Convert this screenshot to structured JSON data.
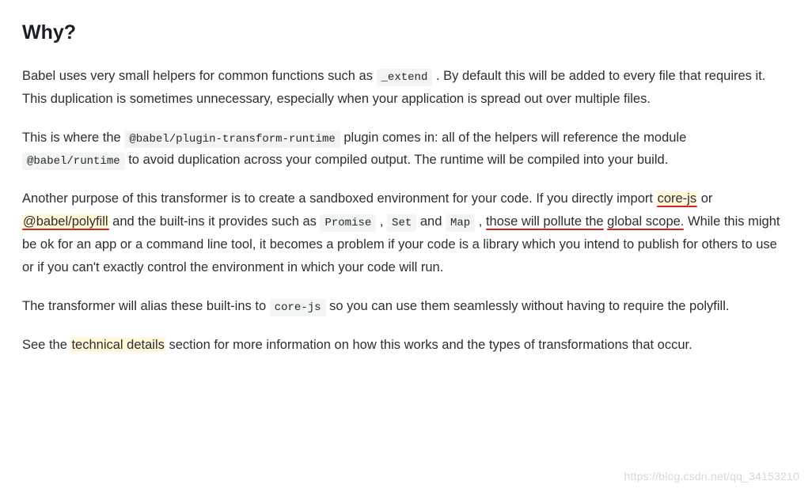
{
  "heading": "Why?",
  "p1": {
    "t1": "Babel uses very small helpers for common functions such as ",
    "c1": "_extend",
    "t2": " . By default this will be added to every file that requires it. This duplication is sometimes unnecessary, especially when your application is spread out over multiple files."
  },
  "p2": {
    "t1": "This is where the ",
    "c1": "@babel/plugin-transform-runtime",
    "t2": " plugin comes in: all of the helpers will reference the module ",
    "c2": "@babel/runtime",
    "t3": " to avoid duplication across your compiled output. The runtime will be compiled into your build."
  },
  "p3": {
    "t1": "Another purpose of this transformer is to create a sandboxed environment for your code. If you directly import ",
    "hl1": "core-js",
    "t2": " or ",
    "hl2": "@babel/polyfill",
    "t3": " and the built-ins it provides such as ",
    "c1": "Promise",
    "sep1": " , ",
    "c2": "Set",
    "sep2": " and ",
    "c3": "Map",
    "sep3": " , ",
    "u1": "those will pollute the",
    "t4": " ",
    "u2": "global scope.",
    "t5": " While this might be ok for an app or a command line tool, it becomes a problem if your code is a library which you intend to publish for others to use or if you can't exactly control the environment in which your code will run."
  },
  "p4": {
    "t1": "The transformer will alias these built-ins to ",
    "c1": "core-js",
    "t2": " so you can use them seamlessly without having to require the polyfill."
  },
  "p5": {
    "t1": "See the ",
    "hl1": "technical details",
    "t2": " section for more information on how this works and the types of transformations that occur."
  },
  "watermark": "https://blog.csdn.net/qq_34153210"
}
